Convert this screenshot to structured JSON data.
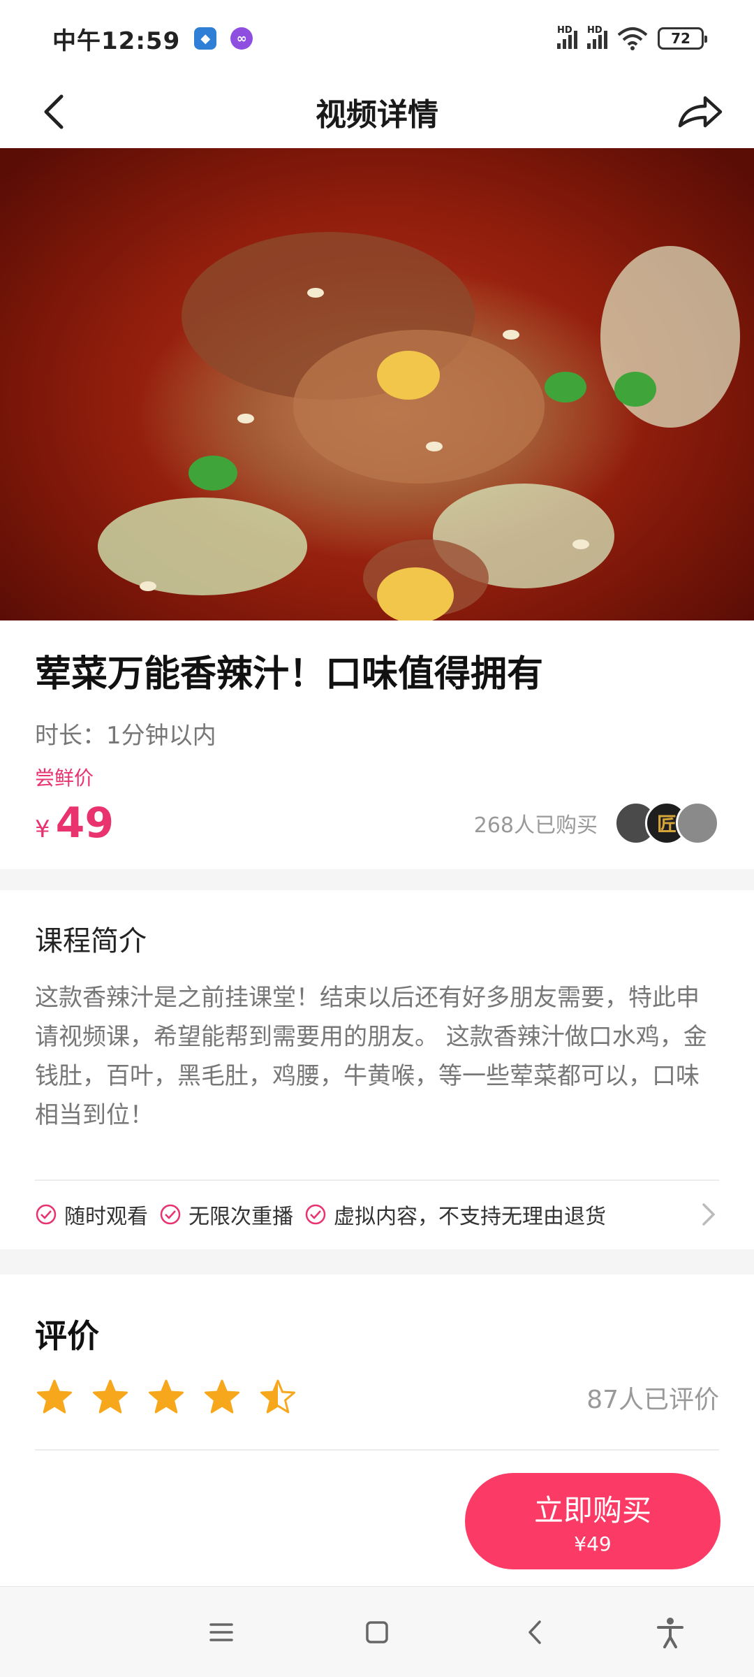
{
  "status_bar": {
    "time": "中午12:59",
    "battery": "72"
  },
  "header": {
    "title": "视频详情"
  },
  "course": {
    "title": "荤菜万能香辣汁！口味值得拥有",
    "duration": "时长：1分钟以内",
    "price_label": "尝鲜价",
    "currency": "¥",
    "price": "49",
    "buyers": "268人已购买",
    "avatar_text": "匠"
  },
  "intro": {
    "heading": "课程简介",
    "text": "这款香辣汁是之前挂课堂！结束以后还有好多朋友需要，特此申请视频课，希望能帮到需要用的朋友。 这款香辣汁做口水鸡，金钱肚，百叶，黑毛肚，鸡腰，牛黄喉，等一些荤菜都可以，口味相当到位！",
    "features": [
      "随时观看",
      "无限次重播",
      "虚拟内容，不支持无理由退货"
    ]
  },
  "reviews": {
    "heading": "评价",
    "rating": 4.5,
    "max": 5,
    "count": "87人已评价"
  },
  "action": {
    "buy_label": "立即购买",
    "buy_price": "¥49"
  },
  "colors": {
    "accent": "#fb3b65",
    "price": "#e8336f",
    "star": "#f7a71b"
  }
}
